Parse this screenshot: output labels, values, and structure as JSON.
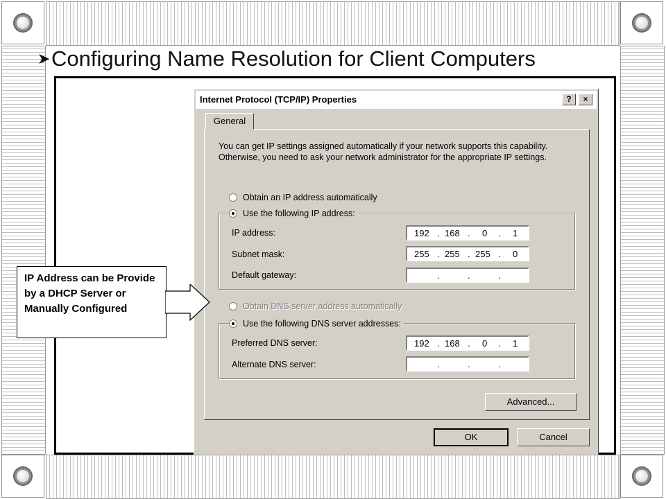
{
  "slide": {
    "title": "Configuring Name Resolution for Client Computers",
    "callout_text": "IP Address can be Provide by a DHCP Server or Manually Configured"
  },
  "dialog": {
    "title": "Internet Protocol (TCP/IP) Properties",
    "help_label": "?",
    "close_label": "×",
    "tab_general": "General",
    "description": "You can get IP settings assigned automatically if your network supports this capability. Otherwise, you need to ask your network administrator for the appropriate IP settings.",
    "ip_mode": {
      "auto_label": "Obtain an IP address automatically",
      "manual_label": "Use the following IP address:",
      "selected": "manual"
    },
    "ip_fields": {
      "ip_address": {
        "label": "IP address:",
        "octets": [
          "192",
          "168",
          "0",
          "1"
        ]
      },
      "subnet_mask": {
        "label": "Subnet mask:",
        "octets": [
          "255",
          "255",
          "255",
          "0"
        ]
      },
      "default_gateway": {
        "label": "Default gateway:",
        "octets": [
          "",
          "",
          "",
          ""
        ]
      }
    },
    "dns_mode": {
      "auto_label": "Obtain DNS server address automatically",
      "manual_label": "Use the following DNS server addresses:",
      "selected": "manual",
      "auto_disabled": true
    },
    "dns_fields": {
      "preferred": {
        "label": "Preferred DNS server:",
        "octets": [
          "192",
          "168",
          "0",
          "1"
        ]
      },
      "alternate": {
        "label": "Alternate DNS server:",
        "octets": [
          "",
          "",
          "",
          ""
        ]
      }
    },
    "buttons": {
      "advanced": "Advanced...",
      "ok": "OK",
      "cancel": "Cancel"
    }
  },
  "icons": [
    "arrow-bullet-icon",
    "help-icon",
    "close-icon",
    "radio-icon",
    "callout-arrow-icon"
  ]
}
